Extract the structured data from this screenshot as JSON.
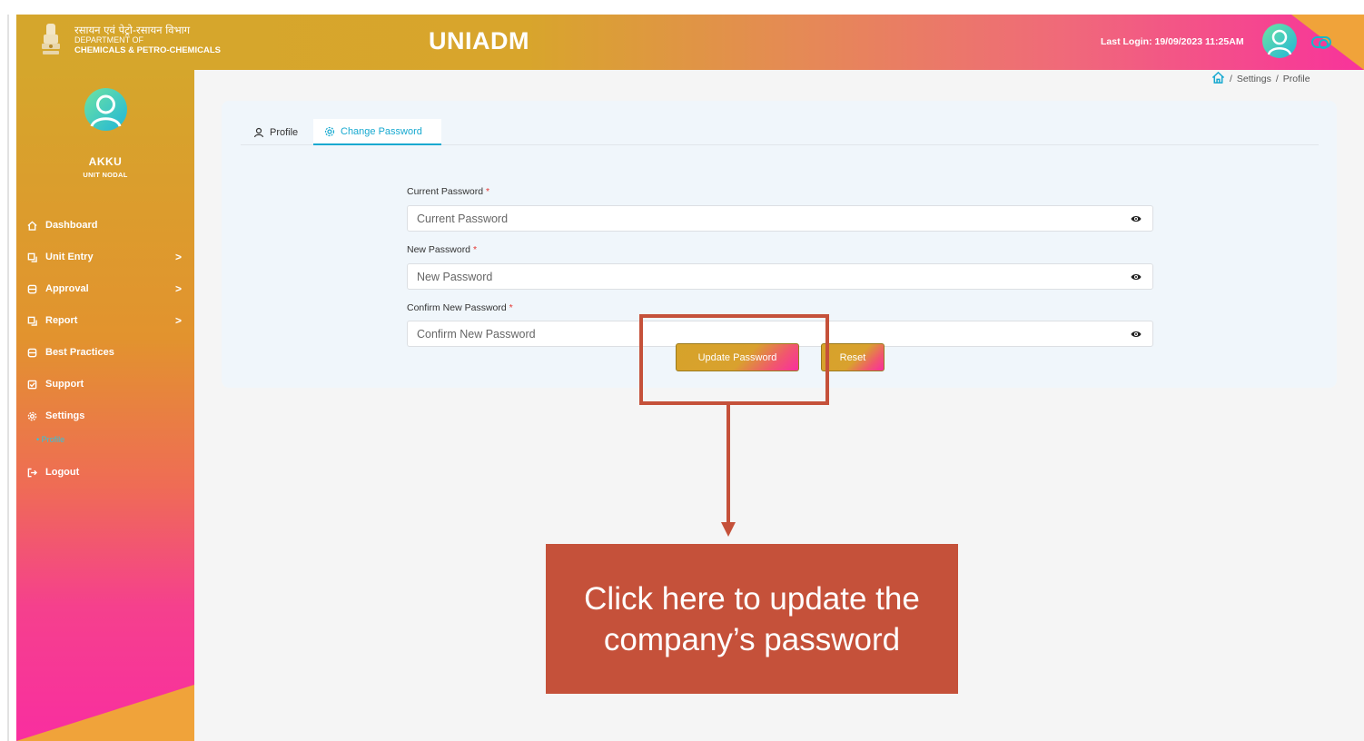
{
  "header": {
    "dept_hindi": "रसायन एवं पेट्रो-रसायन विभाग",
    "dept_line1": "DEPARTMENT OF",
    "dept_line2": "CHEMICALS & PETRO-CHEMICALS",
    "app_title": "UNIADM",
    "last_login": "Last Login: 19/09/2023 11:25AM",
    "icons": [
      "emblem-icon",
      "user-avatar-icon",
      "theme-toggle-icon"
    ]
  },
  "user": {
    "name": "AKKU",
    "role": "UNIT NODAL"
  },
  "sidebar": {
    "items": [
      {
        "label": "Dashboard",
        "icon": "home-icon"
      },
      {
        "label": "Unit Entry",
        "icon": "entry-icon",
        "chevron": ">"
      },
      {
        "label": "Approval",
        "icon": "database-icon",
        "chevron": ">"
      },
      {
        "label": "Report",
        "icon": "report-icon",
        "chevron": ">"
      },
      {
        "label": "Best Practices",
        "icon": "database-icon"
      },
      {
        "label": "Support",
        "icon": "support-icon"
      },
      {
        "label": "Settings",
        "icon": "gear-icon"
      },
      {
        "label": "Logout",
        "icon": "logout-icon"
      }
    ],
    "sub_item": "• Profile"
  },
  "breadcrumb": {
    "sep": "/",
    "parent": "Settings",
    "current": "Profile"
  },
  "tabs": [
    {
      "label": "Profile",
      "icon": "user-icon"
    },
    {
      "label": "Change Password",
      "icon": "gear-icon",
      "active": true
    }
  ],
  "form": {
    "required_mark": "*",
    "fields": [
      {
        "label": "Current Password",
        "placeholder": "Current Password"
      },
      {
        "label": "New Password",
        "placeholder": "New Password"
      },
      {
        "label": "Confirm New Password",
        "placeholder": "Confirm New Password"
      }
    ],
    "update_label": "Update Password",
    "reset_label": "Reset"
  },
  "annotation": {
    "callout_text": "Click here to update the company’s password",
    "color": "#c5513a"
  },
  "colors": {
    "accent": "#17a9d0",
    "gold": "#d5a62c",
    "pink": "#f92ea0"
  }
}
